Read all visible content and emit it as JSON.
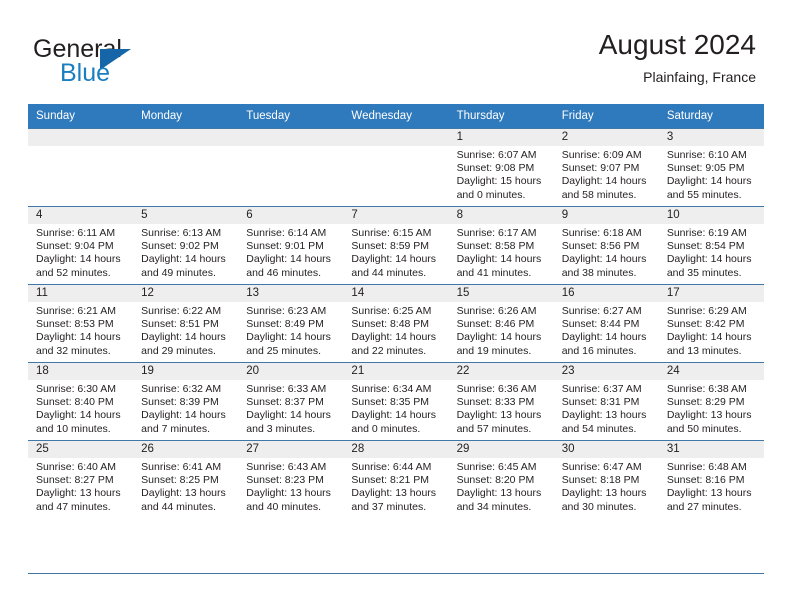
{
  "brand": {
    "name_part1": "General",
    "name_part2": "Blue",
    "logo_icon": "triangle-logo-icon"
  },
  "header": {
    "title": "August 2024",
    "subtitle": "Plainfaing, France"
  },
  "calendar": {
    "weekday_headers": [
      "Sunday",
      "Monday",
      "Tuesday",
      "Wednesday",
      "Thursday",
      "Friday",
      "Saturday"
    ],
    "accent_color": "#2f79bd",
    "daynum_band_color": "#eeeeee",
    "grid_line_color": "#3f77a8",
    "weeks": [
      [
        {
          "day": "",
          "empty": true
        },
        {
          "day": "",
          "empty": true
        },
        {
          "day": "",
          "empty": true
        },
        {
          "day": "",
          "empty": true
        },
        {
          "day": "1",
          "sunrise": "Sunrise: 6:07 AM",
          "sunset": "Sunset: 9:08 PM",
          "daylight1": "Daylight: 15 hours",
          "daylight2": "and 0 minutes."
        },
        {
          "day": "2",
          "sunrise": "Sunrise: 6:09 AM",
          "sunset": "Sunset: 9:07 PM",
          "daylight1": "Daylight: 14 hours",
          "daylight2": "and 58 minutes."
        },
        {
          "day": "3",
          "sunrise": "Sunrise: 6:10 AM",
          "sunset": "Sunset: 9:05 PM",
          "daylight1": "Daylight: 14 hours",
          "daylight2": "and 55 minutes."
        }
      ],
      [
        {
          "day": "4",
          "sunrise": "Sunrise: 6:11 AM",
          "sunset": "Sunset: 9:04 PM",
          "daylight1": "Daylight: 14 hours",
          "daylight2": "and 52 minutes."
        },
        {
          "day": "5",
          "sunrise": "Sunrise: 6:13 AM",
          "sunset": "Sunset: 9:02 PM",
          "daylight1": "Daylight: 14 hours",
          "daylight2": "and 49 minutes."
        },
        {
          "day": "6",
          "sunrise": "Sunrise: 6:14 AM",
          "sunset": "Sunset: 9:01 PM",
          "daylight1": "Daylight: 14 hours",
          "daylight2": "and 46 minutes."
        },
        {
          "day": "7",
          "sunrise": "Sunrise: 6:15 AM",
          "sunset": "Sunset: 8:59 PM",
          "daylight1": "Daylight: 14 hours",
          "daylight2": "and 44 minutes."
        },
        {
          "day": "8",
          "sunrise": "Sunrise: 6:17 AM",
          "sunset": "Sunset: 8:58 PM",
          "daylight1": "Daylight: 14 hours",
          "daylight2": "and 41 minutes."
        },
        {
          "day": "9",
          "sunrise": "Sunrise: 6:18 AM",
          "sunset": "Sunset: 8:56 PM",
          "daylight1": "Daylight: 14 hours",
          "daylight2": "and 38 minutes."
        },
        {
          "day": "10",
          "sunrise": "Sunrise: 6:19 AM",
          "sunset": "Sunset: 8:54 PM",
          "daylight1": "Daylight: 14 hours",
          "daylight2": "and 35 minutes."
        }
      ],
      [
        {
          "day": "11",
          "sunrise": "Sunrise: 6:21 AM",
          "sunset": "Sunset: 8:53 PM",
          "daylight1": "Daylight: 14 hours",
          "daylight2": "and 32 minutes."
        },
        {
          "day": "12",
          "sunrise": "Sunrise: 6:22 AM",
          "sunset": "Sunset: 8:51 PM",
          "daylight1": "Daylight: 14 hours",
          "daylight2": "and 29 minutes."
        },
        {
          "day": "13",
          "sunrise": "Sunrise: 6:23 AM",
          "sunset": "Sunset: 8:49 PM",
          "daylight1": "Daylight: 14 hours",
          "daylight2": "and 25 minutes."
        },
        {
          "day": "14",
          "sunrise": "Sunrise: 6:25 AM",
          "sunset": "Sunset: 8:48 PM",
          "daylight1": "Daylight: 14 hours",
          "daylight2": "and 22 minutes."
        },
        {
          "day": "15",
          "sunrise": "Sunrise: 6:26 AM",
          "sunset": "Sunset: 8:46 PM",
          "daylight1": "Daylight: 14 hours",
          "daylight2": "and 19 minutes."
        },
        {
          "day": "16",
          "sunrise": "Sunrise: 6:27 AM",
          "sunset": "Sunset: 8:44 PM",
          "daylight1": "Daylight: 14 hours",
          "daylight2": "and 16 minutes."
        },
        {
          "day": "17",
          "sunrise": "Sunrise: 6:29 AM",
          "sunset": "Sunset: 8:42 PM",
          "daylight1": "Daylight: 14 hours",
          "daylight2": "and 13 minutes."
        }
      ],
      [
        {
          "day": "18",
          "sunrise": "Sunrise: 6:30 AM",
          "sunset": "Sunset: 8:40 PM",
          "daylight1": "Daylight: 14 hours",
          "daylight2": "and 10 minutes."
        },
        {
          "day": "19",
          "sunrise": "Sunrise: 6:32 AM",
          "sunset": "Sunset: 8:39 PM",
          "daylight1": "Daylight: 14 hours",
          "daylight2": "and 7 minutes."
        },
        {
          "day": "20",
          "sunrise": "Sunrise: 6:33 AM",
          "sunset": "Sunset: 8:37 PM",
          "daylight1": "Daylight: 14 hours",
          "daylight2": "and 3 minutes."
        },
        {
          "day": "21",
          "sunrise": "Sunrise: 6:34 AM",
          "sunset": "Sunset: 8:35 PM",
          "daylight1": "Daylight: 14 hours",
          "daylight2": "and 0 minutes."
        },
        {
          "day": "22",
          "sunrise": "Sunrise: 6:36 AM",
          "sunset": "Sunset: 8:33 PM",
          "daylight1": "Daylight: 13 hours",
          "daylight2": "and 57 minutes."
        },
        {
          "day": "23",
          "sunrise": "Sunrise: 6:37 AM",
          "sunset": "Sunset: 8:31 PM",
          "daylight1": "Daylight: 13 hours",
          "daylight2": "and 54 minutes."
        },
        {
          "day": "24",
          "sunrise": "Sunrise: 6:38 AM",
          "sunset": "Sunset: 8:29 PM",
          "daylight1": "Daylight: 13 hours",
          "daylight2": "and 50 minutes."
        }
      ],
      [
        {
          "day": "25",
          "sunrise": "Sunrise: 6:40 AM",
          "sunset": "Sunset: 8:27 PM",
          "daylight1": "Daylight: 13 hours",
          "daylight2": "and 47 minutes."
        },
        {
          "day": "26",
          "sunrise": "Sunrise: 6:41 AM",
          "sunset": "Sunset: 8:25 PM",
          "daylight1": "Daylight: 13 hours",
          "daylight2": "and 44 minutes."
        },
        {
          "day": "27",
          "sunrise": "Sunrise: 6:43 AM",
          "sunset": "Sunset: 8:23 PM",
          "daylight1": "Daylight: 13 hours",
          "daylight2": "and 40 minutes."
        },
        {
          "day": "28",
          "sunrise": "Sunrise: 6:44 AM",
          "sunset": "Sunset: 8:21 PM",
          "daylight1": "Daylight: 13 hours",
          "daylight2": "and 37 minutes."
        },
        {
          "day": "29",
          "sunrise": "Sunrise: 6:45 AM",
          "sunset": "Sunset: 8:20 PM",
          "daylight1": "Daylight: 13 hours",
          "daylight2": "and 34 minutes."
        },
        {
          "day": "30",
          "sunrise": "Sunrise: 6:47 AM",
          "sunset": "Sunset: 8:18 PM",
          "daylight1": "Daylight: 13 hours",
          "daylight2": "and 30 minutes."
        },
        {
          "day": "31",
          "sunrise": "Sunrise: 6:48 AM",
          "sunset": "Sunset: 8:16 PM",
          "daylight1": "Daylight: 13 hours",
          "daylight2": "and 27 minutes."
        }
      ]
    ]
  }
}
